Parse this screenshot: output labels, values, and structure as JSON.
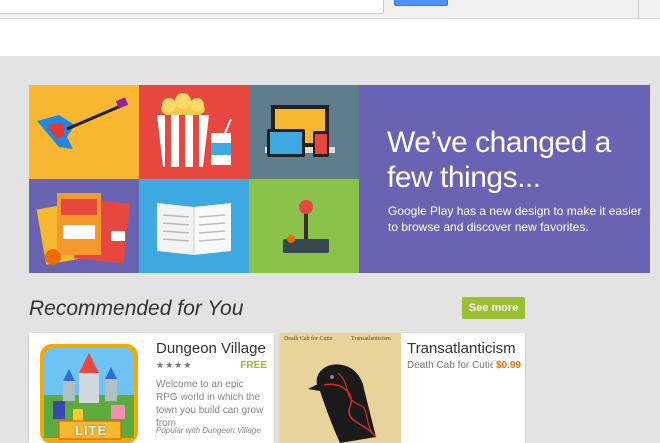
{
  "promo": {
    "title": "We’ve changed a few things...",
    "description": "Google Play has a new design to make it easier to browse and discover new favorites."
  },
  "recommended": {
    "title": "Recommended for You",
    "see_more": "See more",
    "cards": [
      {
        "title": "Dungeon Village",
        "stars": "★★★★",
        "price": "FREE",
        "description": "Welcome to an epic RPG world in which the town you build can grow from",
        "footer": "Popular with Dungeon Village",
        "art_label": "LITE"
      },
      {
        "title": "Transatlanticism",
        "developer": "Death Cab for Cutie",
        "price": "$0.99",
        "art_left": "Death Cab for Cutie",
        "art_right": "Transatlanticism"
      }
    ]
  },
  "colors": {
    "promo_bg": "#6864b3",
    "tile_yellow": "#f7b731",
    "tile_red": "#e8473f",
    "tile_slate": "#5f7d8a",
    "tile_purple": "#6864b3",
    "tile_blue": "#3da9e0",
    "tile_green": "#8bc34a",
    "see_more": "#9abf2f"
  },
  "icons": [
    "guitar-icon",
    "popcorn-icon",
    "devices-icon",
    "magazine-icon",
    "book-icon",
    "joystick-icon",
    "search-button"
  ]
}
